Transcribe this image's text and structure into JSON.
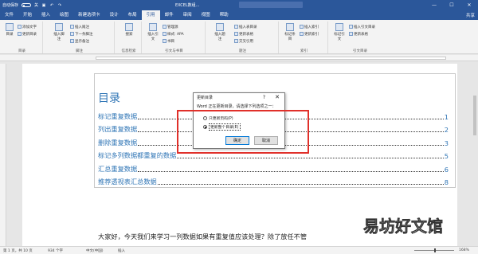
{
  "titlebar": {
    "autosave_label": "自动保存",
    "autosave_state": "关",
    "doc_title": "EXCEL数组...",
    "minimize": "—",
    "maximize": "☐",
    "close": "✕"
  },
  "tabs": [
    "文件",
    "开始",
    "插入",
    "绘图",
    "新建选项卡",
    "设计",
    "布局",
    "引用",
    "邮件",
    "审阅",
    "视图",
    "帮助"
  ],
  "active_tab": "引用",
  "share_label": "共享",
  "ribbon": {
    "toc_group": {
      "label": "目录",
      "big": "目录",
      "items": [
        "添加文字",
        "更新目录"
      ]
    },
    "footnote_group": {
      "label": "脚注",
      "big": "插入脚注",
      "items": [
        "插入尾注",
        "下一条脚注",
        "显示备注"
      ]
    },
    "search_group": {
      "label": "信息检索",
      "big": "搜索"
    },
    "citation_group": {
      "label": "引文与书目",
      "big": "插入引文",
      "items": [
        "管理源",
        "样式: APA",
        "书目"
      ]
    },
    "caption_group": {
      "label": "题注",
      "big": "插入题注",
      "items": [
        "插入表目录",
        "更新表格",
        "交叉引用"
      ]
    },
    "index_group": {
      "label": "索引",
      "big": "标记条目",
      "items": [
        "插入索引",
        "更新索引"
      ]
    },
    "toa_group": {
      "label": "引文目录",
      "big": "标记引文",
      "items": [
        "插入引文目录",
        "更新表格"
      ]
    }
  },
  "document": {
    "toc_title": "目录",
    "toc_entries": [
      {
        "text": "标记重复数据",
        "page": "1"
      },
      {
        "text": "列出重复数据",
        "page": "2"
      },
      {
        "text": "删除重复数据",
        "page": "3"
      },
      {
        "text": "标记多列数据都重复的数据",
        "page": "5"
      },
      {
        "text": "汇总重复数据",
        "page": "6"
      },
      {
        "text": "推荐透视表汇总数据",
        "page": "8"
      }
    ],
    "body_text": "大家好，今天我们来学习一列数据如果有重复值应该处理？除了放任不管"
  },
  "dialog": {
    "title": "更新目录",
    "help": "?",
    "close": "✕",
    "message": "Word 正在更新目录，请选择下列选项之一：",
    "options": [
      {
        "label": "只更新页码(P)",
        "selected": false
      },
      {
        "label": "更新整个目录(E)",
        "selected": true
      }
    ],
    "ok": "确定",
    "cancel": "取消"
  },
  "statusbar": {
    "page": "第 1 页，共 10 页",
    "words": "934 个字",
    "language": "中文(中国)",
    "mode": "插入",
    "zoom": "168%"
  },
  "watermark": "易坊好文馆",
  "colors": {
    "brand": "#2b579a",
    "toc_blue": "#2e74b5",
    "highlight_red": "#e0302a"
  }
}
